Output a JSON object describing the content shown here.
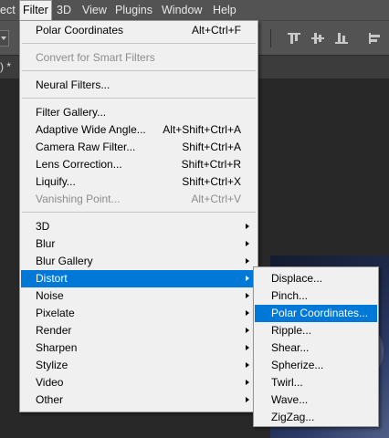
{
  "menubar": {
    "items": [
      {
        "label": "ect"
      },
      {
        "label": "Filter"
      },
      {
        "label": "3D"
      },
      {
        "label": "View"
      },
      {
        "label": "Plugins"
      },
      {
        "label": "Window"
      },
      {
        "label": "Help"
      }
    ]
  },
  "document_tab": {
    "label": ") *"
  },
  "filter_menu": {
    "items": [
      {
        "label": "Polar Coordinates",
        "shortcut": "Alt+Ctrl+F"
      },
      {
        "label": "Convert for Smart Filters"
      },
      {
        "label": "Neural Filters..."
      },
      {
        "label": "Filter Gallery..."
      },
      {
        "label": "Adaptive Wide Angle...",
        "shortcut": "Alt+Shift+Ctrl+A"
      },
      {
        "label": "Camera Raw Filter...",
        "shortcut": "Shift+Ctrl+A"
      },
      {
        "label": "Lens Correction...",
        "shortcut": "Shift+Ctrl+R"
      },
      {
        "label": "Liquify...",
        "shortcut": "Shift+Ctrl+X"
      },
      {
        "label": "Vanishing Point...",
        "shortcut": "Alt+Ctrl+V"
      },
      {
        "label": "3D"
      },
      {
        "label": "Blur"
      },
      {
        "label": "Blur Gallery"
      },
      {
        "label": "Distort"
      },
      {
        "label": "Noise"
      },
      {
        "label": "Pixelate"
      },
      {
        "label": "Render"
      },
      {
        "label": "Sharpen"
      },
      {
        "label": "Stylize"
      },
      {
        "label": "Video"
      },
      {
        "label": "Other"
      }
    ]
  },
  "distort_submenu": {
    "items": [
      {
        "label": "Displace..."
      },
      {
        "label": "Pinch..."
      },
      {
        "label": "Polar Coordinates..."
      },
      {
        "label": "Ripple..."
      },
      {
        "label": "Shear..."
      },
      {
        "label": "Spherize..."
      },
      {
        "label": "Twirl..."
      },
      {
        "label": "Wave..."
      },
      {
        "label": "ZigZag..."
      }
    ]
  },
  "colors": {
    "highlight": "#0078d7",
    "menu_bg": "#f0f0f0",
    "disabled_text": "#8d8d8d",
    "chrome_bg": "#535353",
    "canvas_bg": "#282828"
  }
}
